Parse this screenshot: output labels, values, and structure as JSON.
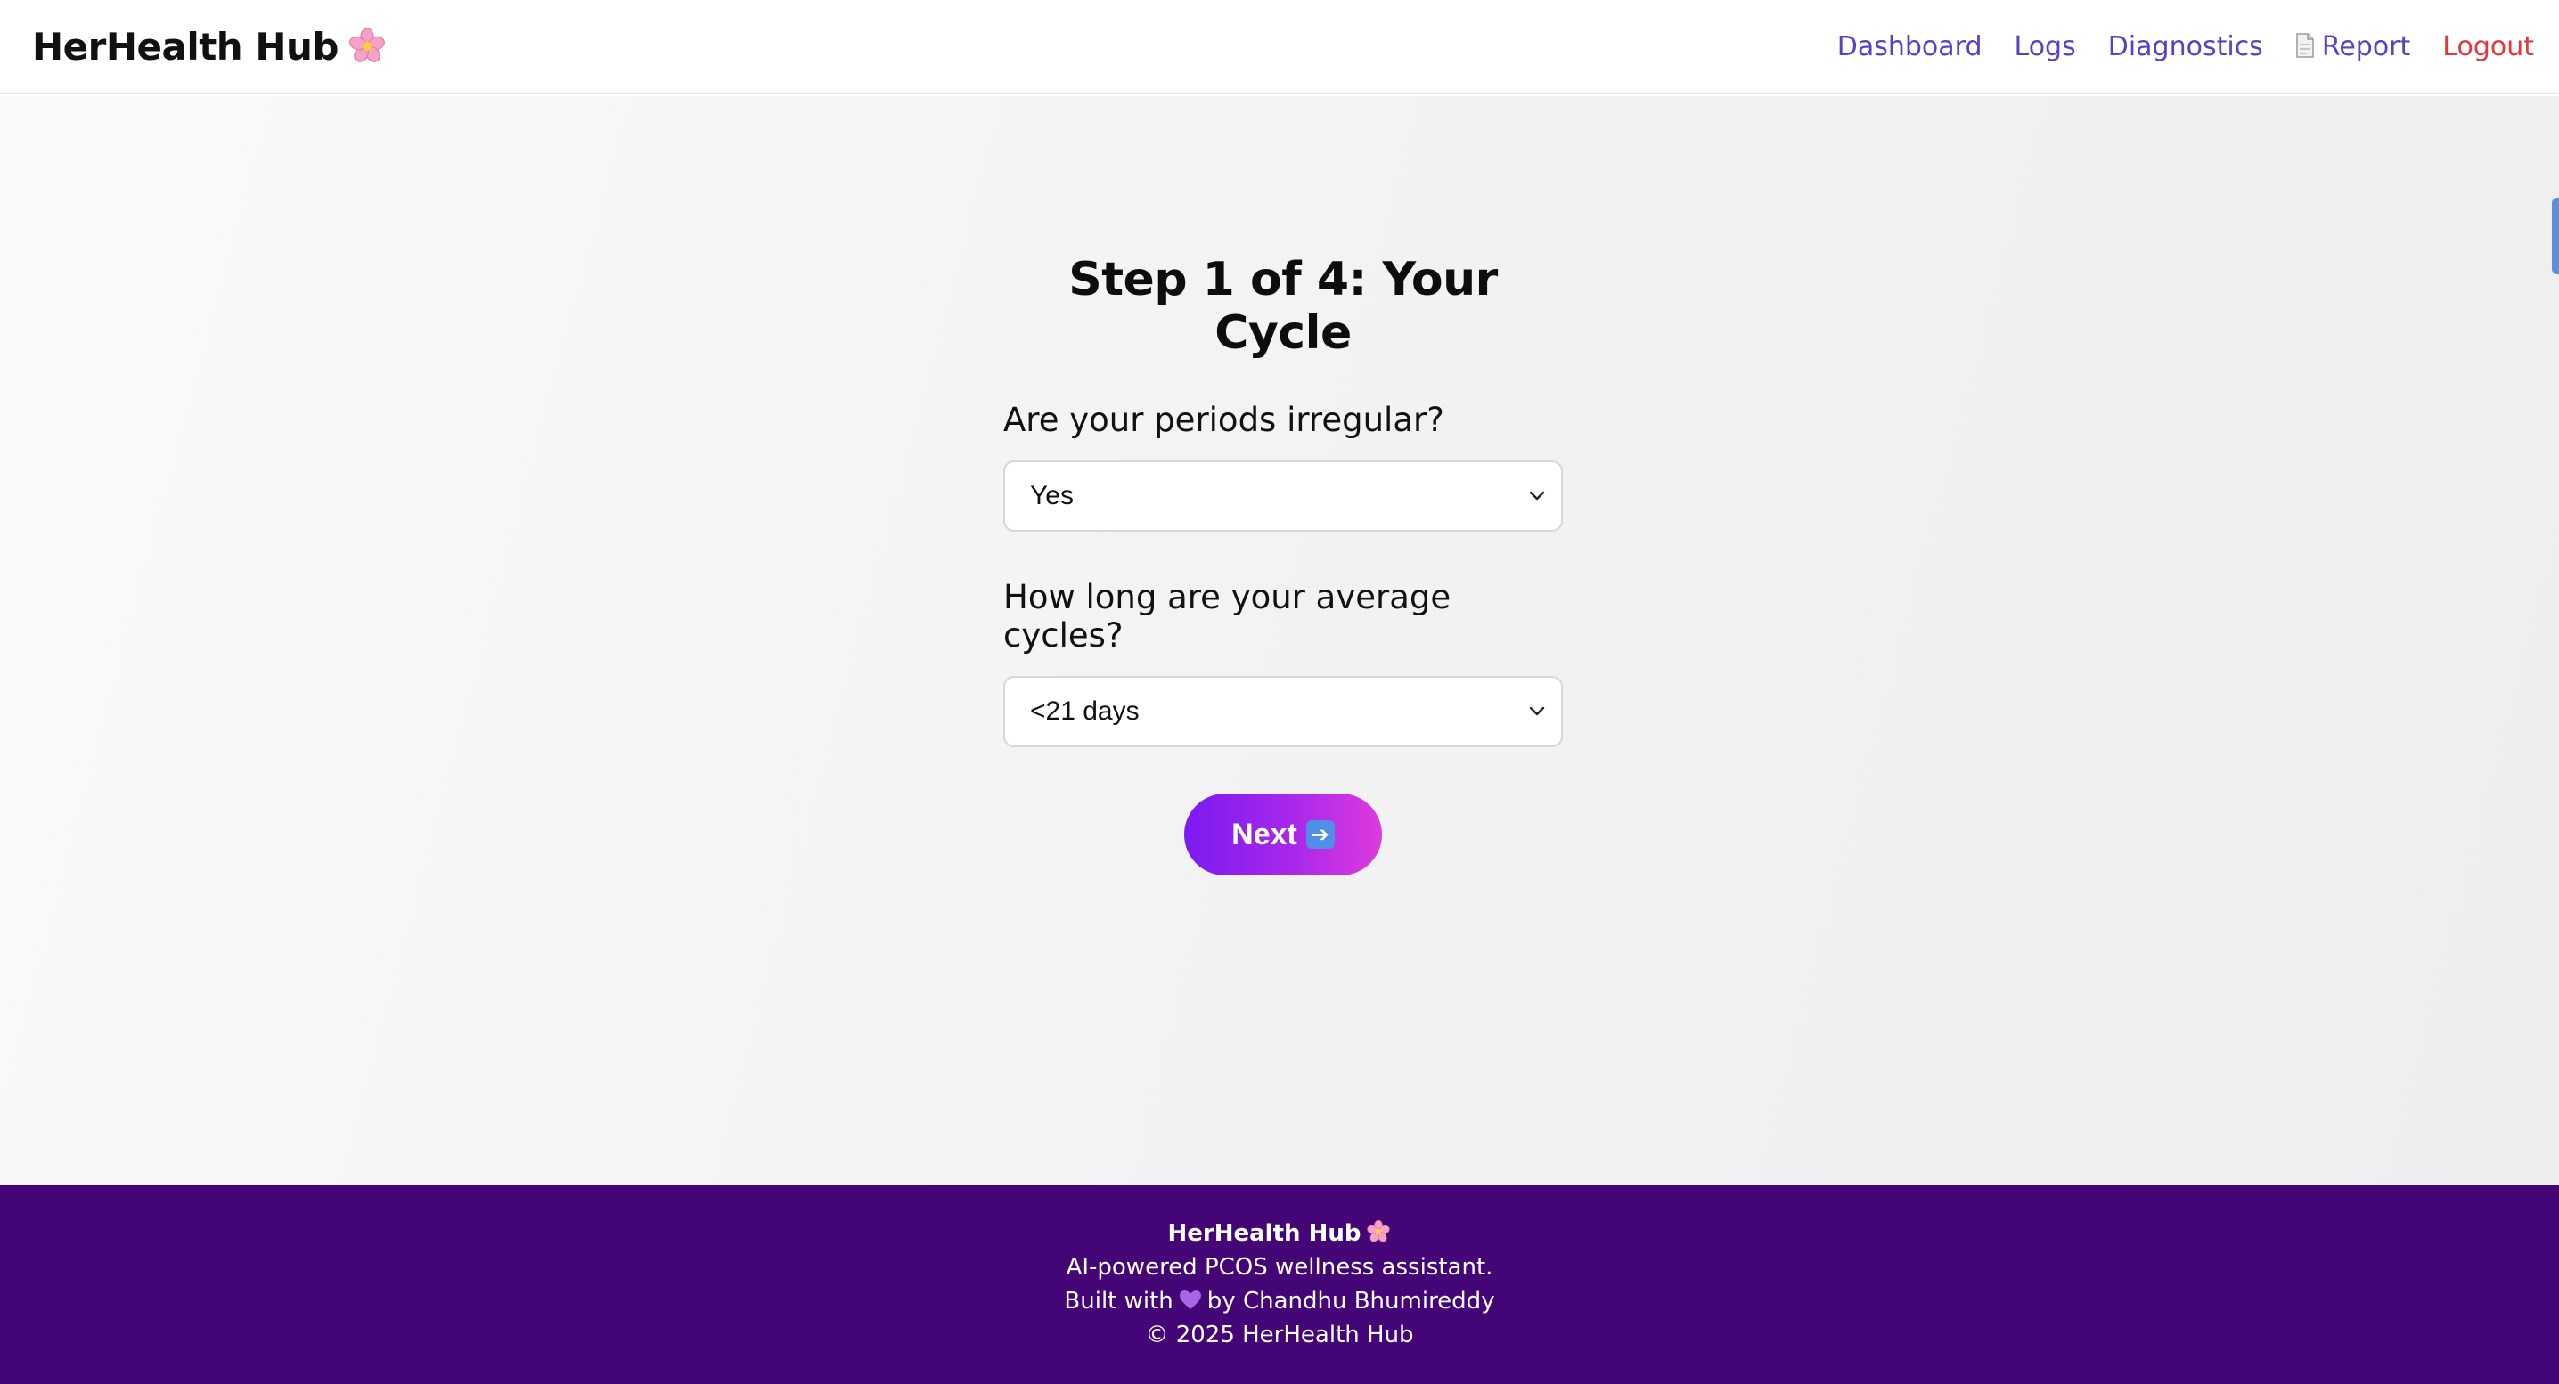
{
  "header": {
    "brand": "HerHealth Hub",
    "brand_icon": "cherry-blossom-icon",
    "nav": {
      "dashboard": "Dashboard",
      "logs": "Logs",
      "diagnostics": "Diagnostics",
      "report": "Report",
      "logout": "Logout"
    },
    "colors": {
      "nav_link": "#5b3fc4",
      "logout": "#e0393e"
    }
  },
  "form": {
    "title": "Step 1 of 4: Your Cycle",
    "questions": [
      {
        "label": "Are your periods irregular?",
        "value": "Yes"
      },
      {
        "label": "How long are your average cycles?",
        "value": "<21 days"
      }
    ],
    "next_label": "Next",
    "next_icon": "right-arrow-icon"
  },
  "footer": {
    "brand": "HerHealth Hub",
    "tagline": "AI-powered PCOS wellness assistant.",
    "built_prefix": "Built with",
    "built_suffix": "by Chandhu Bhumireddy",
    "copyright": "© 2025 HerHealth Hub",
    "background": "#440677"
  }
}
